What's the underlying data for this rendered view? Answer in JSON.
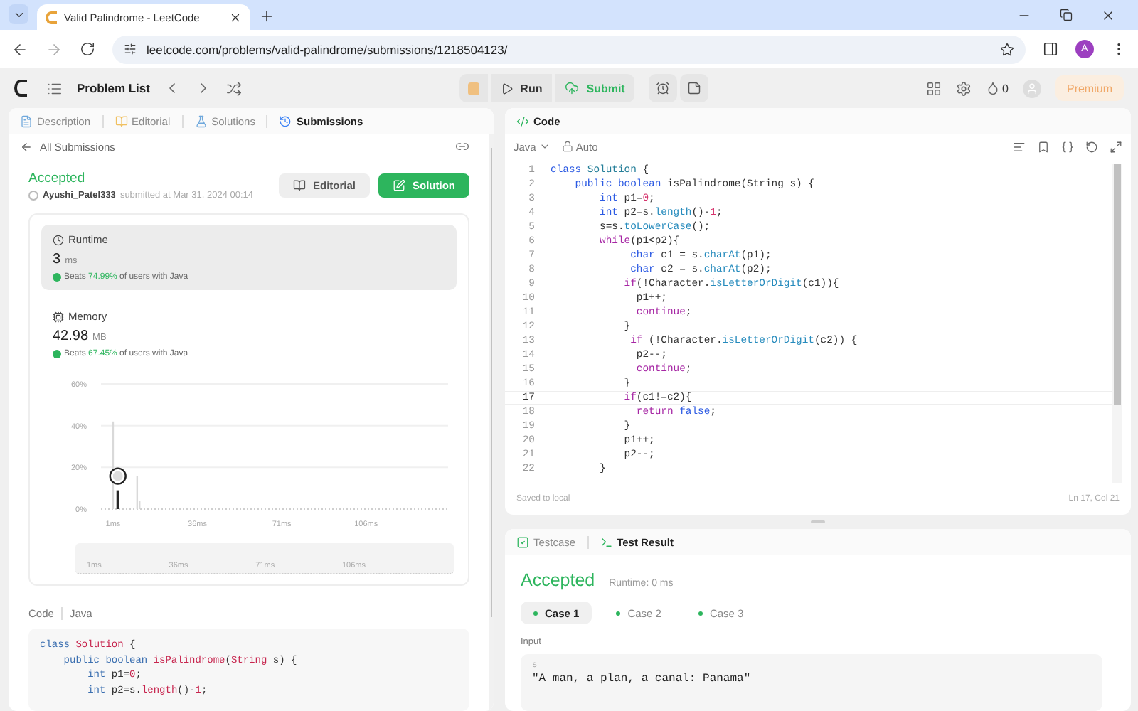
{
  "browser": {
    "tab_title": "Valid Palindrome - LeetCode",
    "url": "leetcode.com/problems/valid-palindrome/submissions/1218504123/",
    "avatar_letter": "A"
  },
  "nav": {
    "problem_list": "Problem List",
    "run": "Run",
    "submit": "Submit",
    "streak": "0",
    "premium": "Premium"
  },
  "left_tabs": [
    {
      "label": "Description",
      "selected": false
    },
    {
      "label": "Editorial",
      "selected": false
    },
    {
      "label": "Solutions",
      "selected": false
    },
    {
      "label": "Submissions",
      "selected": true
    }
  ],
  "back_link": "All Submissions",
  "submission": {
    "status": "Accepted",
    "user": "Ayushi_Patel333",
    "submitted": "submitted at Mar 31, 2024 00:14",
    "buttons": [
      {
        "label": "Editorial",
        "kind": "secondary"
      },
      {
        "label": "Solution",
        "kind": "primary"
      }
    ]
  },
  "metrics": [
    {
      "kind": "runtime",
      "title": "Runtime",
      "value": "3",
      "unit": "ms",
      "beats": "Beats",
      "percent": "74.99%",
      "suffix": "of users with Java",
      "selected": true
    },
    {
      "kind": "memory",
      "title": "Memory",
      "value": "42.98",
      "unit": "MB",
      "beats": "Beats",
      "percent": "67.45%",
      "suffix": "of users with Java",
      "selected": false
    }
  ],
  "chart_data": {
    "type": "bar",
    "x": [
      1,
      3,
      11,
      12
    ],
    "series": [
      {
        "color": "#d9d9d9",
        "values": [
          42,
          null,
          16,
          4
        ]
      },
      {
        "color": "#262626",
        "values": [
          null,
          9,
          null,
          null
        ]
      }
    ],
    "xlim": [
      -4,
      140
    ],
    "ylim": [
      0,
      60
    ],
    "xticks": [
      {
        "value": 1,
        "label": "1ms"
      },
      {
        "value": 36,
        "label": "36ms"
      },
      {
        "value": 71,
        "label": "71ms"
      },
      {
        "value": 106,
        "label": "106ms"
      }
    ],
    "yticks": [
      {
        "value": 0,
        "label": "0%"
      },
      {
        "value": 20,
        "label": "20%"
      },
      {
        "value": 40,
        "label": "40%"
      },
      {
        "value": 60,
        "label": "60%"
      }
    ]
  },
  "brush_ticks": [
    "1ms",
    "36ms",
    "71ms",
    "106ms"
  ],
  "code_section": {
    "title": "Code",
    "language": "Java"
  },
  "code_preview": [
    [
      {
        "kind": "kw",
        "text": "class "
      },
      {
        "kind": "cls",
        "text": "Solution"
      },
      {
        "kind": "p",
        "text": " {"
      }
    ],
    [
      {
        "kind": "kw",
        "text": "    public boolean "
      },
      {
        "kind": "cls",
        "text": "isPalindrome"
      },
      {
        "kind": "p",
        "text": "("
      },
      {
        "kind": "cls",
        "text": "String"
      },
      {
        "kind": "p",
        "text": " s) {"
      }
    ],
    [
      {
        "kind": "kw",
        "text": "        int"
      },
      {
        "kind": "p",
        "text": " p1="
      },
      {
        "kind": "num",
        "text": "0"
      },
      {
        "kind": "p",
        "text": ";"
      }
    ],
    [
      {
        "kind": "kw",
        "text": "        int"
      },
      {
        "kind": "p",
        "text": " p2=s."
      },
      {
        "kind": "cls",
        "text": "length"
      },
      {
        "kind": "p",
        "text": "()-"
      },
      {
        "kind": "num",
        "text": "1"
      },
      {
        "kind": "p",
        "text": ";"
      }
    ]
  ],
  "editor": {
    "title": "Code",
    "language": "Java",
    "mode": "Auto",
    "lines": [
      {
        "n": "1",
        "selected": false,
        "seg": [
          {
            "kind": "kw",
            "text": "class "
          },
          {
            "kind": "cls",
            "text": "Solution"
          },
          {
            "kind": "p",
            "text": " {"
          }
        ]
      },
      {
        "n": "2",
        "selected": false,
        "seg": [
          {
            "kind": "kw",
            "text": "    public boolean "
          },
          {
            "kind": "p",
            "text": "isPalindrome(String s) {"
          }
        ]
      },
      {
        "n": "3",
        "selected": false,
        "seg": [
          {
            "kind": "kw",
            "text": "        int"
          },
          {
            "kind": "p",
            "text": " p1="
          },
          {
            "kind": "num",
            "text": "0"
          },
          {
            "kind": "p",
            "text": ";"
          }
        ]
      },
      {
        "n": "4",
        "selected": false,
        "seg": [
          {
            "kind": "kw",
            "text": "        int"
          },
          {
            "kind": "p",
            "text": " p2=s."
          },
          {
            "kind": "fn",
            "text": "length"
          },
          {
            "kind": "p",
            "text": "()-"
          },
          {
            "kind": "num",
            "text": "1"
          },
          {
            "kind": "p",
            "text": ";"
          }
        ]
      },
      {
        "n": "5",
        "selected": false,
        "seg": [
          {
            "kind": "p",
            "text": "        s=s."
          },
          {
            "kind": "fn",
            "text": "toLowerCase"
          },
          {
            "kind": "p",
            "text": "();"
          }
        ]
      },
      {
        "n": "6",
        "selected": false,
        "seg": [
          {
            "kind": "ctl",
            "text": "        while"
          },
          {
            "kind": "p",
            "text": "(p1<p2){"
          }
        ]
      },
      {
        "n": "7",
        "selected": false,
        "seg": [
          {
            "kind": "kw",
            "text": "             char"
          },
          {
            "kind": "p",
            "text": " c1 = s."
          },
          {
            "kind": "fn",
            "text": "charAt"
          },
          {
            "kind": "p",
            "text": "(p1);"
          }
        ]
      },
      {
        "n": "8",
        "selected": false,
        "seg": [
          {
            "kind": "kw",
            "text": "             char"
          },
          {
            "kind": "p",
            "text": " c2 = s."
          },
          {
            "kind": "fn",
            "text": "charAt"
          },
          {
            "kind": "p",
            "text": "(p2);"
          }
        ]
      },
      {
        "n": "9",
        "selected": false,
        "seg": [
          {
            "kind": "ctl",
            "text": "            if"
          },
          {
            "kind": "p",
            "text": "(!Character."
          },
          {
            "kind": "fn",
            "text": "isLetterOrDigit"
          },
          {
            "kind": "p",
            "text": "(c1)){"
          }
        ]
      },
      {
        "n": "10",
        "selected": false,
        "seg": [
          {
            "kind": "p",
            "text": "              p1++;"
          }
        ]
      },
      {
        "n": "11",
        "selected": false,
        "seg": [
          {
            "kind": "ctl",
            "text": "              continue"
          },
          {
            "kind": "p",
            "text": ";"
          }
        ]
      },
      {
        "n": "12",
        "selected": false,
        "seg": [
          {
            "kind": "p",
            "text": "            }"
          }
        ]
      },
      {
        "n": "13",
        "selected": false,
        "seg": [
          {
            "kind": "ctl",
            "text": "             if"
          },
          {
            "kind": "p",
            "text": " (!Character."
          },
          {
            "kind": "fn",
            "text": "isLetterOrDigit"
          },
          {
            "kind": "p",
            "text": "(c2)) {"
          }
        ]
      },
      {
        "n": "14",
        "selected": false,
        "seg": [
          {
            "kind": "p",
            "text": "              p2--;"
          }
        ]
      },
      {
        "n": "15",
        "selected": false,
        "seg": [
          {
            "kind": "ctl",
            "text": "              continue"
          },
          {
            "kind": "p",
            "text": ";"
          }
        ]
      },
      {
        "n": "16",
        "selected": false,
        "seg": [
          {
            "kind": "p",
            "text": "            }"
          }
        ]
      },
      {
        "n": "17",
        "selected": true,
        "seg": [
          {
            "kind": "ctl",
            "text": "            if"
          },
          {
            "kind": "p",
            "text": "(c1!=c2){"
          }
        ]
      },
      {
        "n": "18",
        "selected": false,
        "seg": [
          {
            "kind": "ctl",
            "text": "              return"
          },
          {
            "kind": "kw",
            "text": " false"
          },
          {
            "kind": "p",
            "text": ";"
          }
        ]
      },
      {
        "n": "19",
        "selected": false,
        "seg": [
          {
            "kind": "p",
            "text": "            }"
          }
        ]
      },
      {
        "n": "20",
        "selected": false,
        "seg": [
          {
            "kind": "p",
            "text": "            p1++;"
          }
        ]
      },
      {
        "n": "21",
        "selected": false,
        "seg": [
          {
            "kind": "p",
            "text": "            p2--;"
          }
        ]
      },
      {
        "n": "22",
        "selected": false,
        "seg": [
          {
            "kind": "p",
            "text": "        }"
          }
        ]
      }
    ],
    "status_left": "Saved to local",
    "status_right": "Ln 17, Col 21"
  },
  "test_tabs": [
    {
      "label": "Testcase",
      "selected": false
    },
    {
      "label": "Test Result",
      "selected": true
    }
  ],
  "test_result": {
    "status": "Accepted",
    "runtime": "Runtime: 0 ms",
    "cases": [
      {
        "label": "Case 1",
        "selected": true
      },
      {
        "label": "Case 2",
        "selected": false
      },
      {
        "label": "Case 3",
        "selected": false
      }
    ],
    "input_label": "Input",
    "input_var": "s =",
    "input_value": "\"A man, a plan, a canal: Panama\""
  }
}
